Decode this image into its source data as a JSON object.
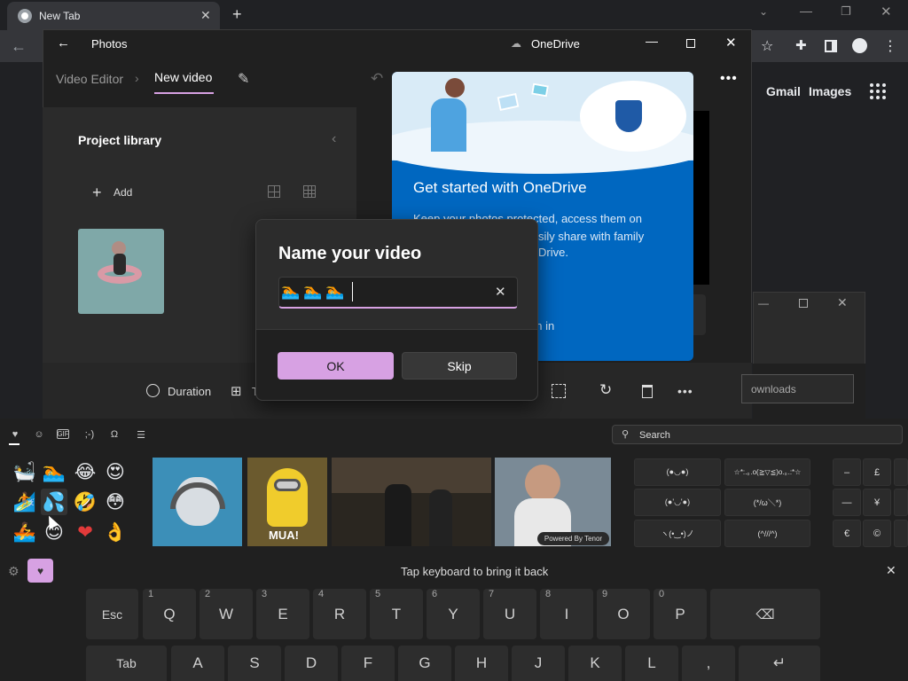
{
  "chrome": {
    "tab_title": "New Tab",
    "links": [
      "Gmail",
      "Images"
    ]
  },
  "photos": {
    "title": "Photos",
    "onedrive_label": "OneDrive",
    "breadcrumb_parent": "Video Editor",
    "breadcrumb_current": "New video",
    "library_title": "Project library",
    "add_label": "Add",
    "duration_label": "Duration",
    "t_label": "T"
  },
  "onedrive_panel": {
    "heading": "Get started with OneDrive",
    "body_line1": "Keep your photos protected, access them on",
    "body_line2": "sily share with family",
    "body_line3": "Drive.",
    "signin": "gn in"
  },
  "dialog": {
    "title": "Name your video",
    "input_value": "🏊🏊🏊",
    "ok_label": "OK",
    "skip_label": "Skip"
  },
  "downloads_window": {
    "field_text": "ownloads"
  },
  "keyboard": {
    "search_placeholder": "Search",
    "categories": [
      "♥",
      "☺",
      "GIF",
      ";-)",
      "Ω",
      "☰"
    ],
    "emojis": [
      "🛀",
      "🏊",
      "😂",
      "😍",
      "🏄",
      "💦",
      "🤣",
      "😳",
      "🚣",
      "😊",
      "❤",
      "👌"
    ],
    "powered_by": "Powered By Tenor",
    "gif2_caption": "MUA!",
    "kaomoji": [
      "(●◡●)",
      "☆*:.｡.o(≧▽≦)o.｡.:*☆",
      "(●'◡'●)",
      "(*/ω＼*)",
      "ヽ(•‿•)ノ",
      "(^///^)"
    ],
    "symbols": [
      "–",
      "£",
      "—",
      "¥",
      "€",
      "©"
    ],
    "tap_message": "Tap keyboard to bring it back",
    "row1": [
      {
        "label": "Esc",
        "num": ""
      },
      {
        "label": "Q",
        "num": "1"
      },
      {
        "label": "W",
        "num": "2"
      },
      {
        "label": "E",
        "num": "3"
      },
      {
        "label": "R",
        "num": "4"
      },
      {
        "label": "T",
        "num": "5"
      },
      {
        "label": "Y",
        "num": "6"
      },
      {
        "label": "U",
        "num": "7"
      },
      {
        "label": "I",
        "num": "8"
      },
      {
        "label": "O",
        "num": "9"
      },
      {
        "label": "P",
        "num": "0"
      }
    ],
    "row2": [
      "Tab",
      "A",
      "S",
      "D",
      "F",
      "G",
      "H",
      "J",
      "K",
      "L",
      ",",
      "↵"
    ]
  },
  "colors": {
    "accent_purple": "#d7a1e3",
    "onedrive_blue": "#0067c0"
  }
}
